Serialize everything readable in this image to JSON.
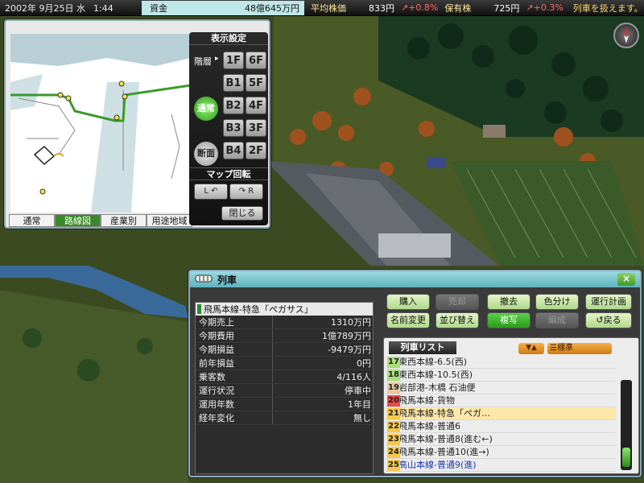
{
  "status_bar": {
    "date": "2002年 9月25日 水",
    "time": "1:44",
    "fund_label": "資金",
    "fund_value": "48億645万円",
    "stock_avg_label": "平均株価",
    "stock_avg_value": "833円",
    "stock_avg_change": "+0.8%",
    "holdings_label": "保有株",
    "holdings_value": "725円",
    "holdings_change": "+0.3%",
    "ticker": "列車を扱えます。"
  },
  "minimap": {
    "tabs": [
      "通常",
      "路線図",
      "産業別",
      "用途地域"
    ],
    "active_tab": "路線図",
    "panel_title": "表示設定",
    "floor_label": "階層",
    "mode_normal": "通常",
    "mode_section": "断面",
    "floors_left": [
      "1F",
      "B1",
      "B2",
      "B3",
      "B4"
    ],
    "floors_right": [
      "6F",
      "5F",
      "4F",
      "3F",
      "2F"
    ],
    "rotate_title": "マップ回転",
    "rotate_left": "L",
    "rotate_right": "R",
    "close": "閉じる"
  },
  "train_window": {
    "title": "列車",
    "close": "×",
    "selected_train": "飛馬本線-特急「ペガサス」",
    "info_rows": [
      {
        "label": "今期売上",
        "value": "1310万円"
      },
      {
        "label": "今期費用",
        "value": "1億789万円"
      },
      {
        "label": "今期損益",
        "value": "-9479万円"
      },
      {
        "label": "前年損益",
        "value": "0円"
      },
      {
        "label": "乗客数",
        "value": "4/116人"
      },
      {
        "label": "運行状況",
        "value": "停車中"
      },
      {
        "label": "運用年数",
        "value": "1年目"
      },
      {
        "label": "経年変化",
        "value": "無し"
      }
    ],
    "buttons": {
      "buy": "購入",
      "sell": "売却",
      "remove": "撤去",
      "color": "色分け",
      "schedule": "運行計画",
      "rename": "名前変更",
      "sort": "並び替え",
      "copy": "複写",
      "formation": "編成",
      "back": "戻る"
    },
    "list_title": "列車リスト",
    "sort_arrows": "▼▲",
    "sort_mode": "標準",
    "trains": [
      {
        "id": "17",
        "name": "東西本線-6.5(西)",
        "id_color": "#a8e07a"
      },
      {
        "id": "18",
        "name": "東西本線-10.5(西)",
        "id_color": "#a8e07a"
      },
      {
        "id": "19",
        "name": "岩部港-木橋 石油便",
        "id_color": "#e8c8a0"
      },
      {
        "id": "20",
        "name": "飛馬本線-貨物",
        "id_color": "#e84a4a"
      },
      {
        "id": "21",
        "name": "飛馬本線-特急「ペガ…",
        "id_color": "#f6c84a"
      },
      {
        "id": "22",
        "name": "飛馬本線-普通6",
        "id_color": "#f6c84a"
      },
      {
        "id": "23",
        "name": "飛馬本線-普通8(進む←)",
        "id_color": "#f6c84a"
      },
      {
        "id": "24",
        "name": "飛馬本線-普通10(進→)",
        "id_color": "#f6c84a"
      },
      {
        "id": "25",
        "name": "高山本線-普通9(進)",
        "id_color": "#f6c84a"
      }
    ],
    "selected_index": 4
  },
  "colors": {
    "accent_green": "#2b9a1c",
    "title_cyan": "#5fb2bd",
    "route_green": "#3a9a2a",
    "change_up": "#ff6a6a"
  }
}
